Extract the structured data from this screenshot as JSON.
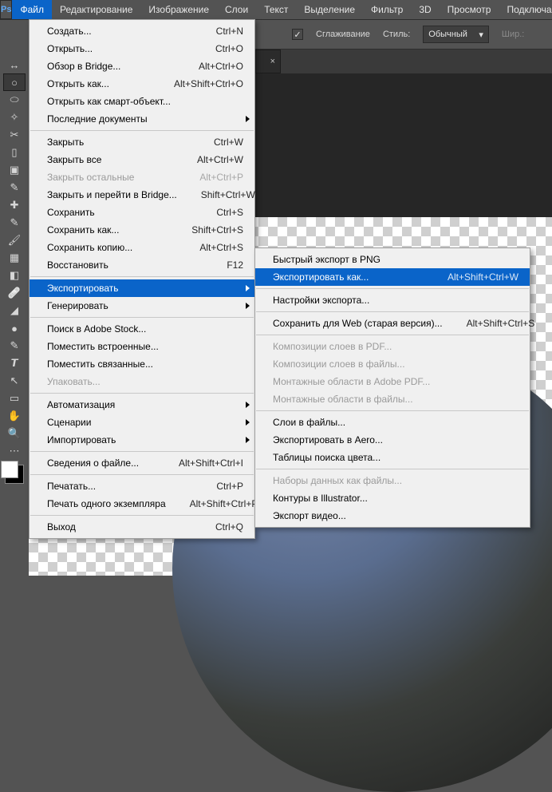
{
  "menubar": {
    "items": [
      "Файл",
      "Редактирование",
      "Изображение",
      "Слои",
      "Текст",
      "Выделение",
      "Фильтр",
      "3D",
      "Просмотр",
      "Подключаемые модул"
    ]
  },
  "options": {
    "smoothing_label": "Сглаживание",
    "style_label": "Стиль:",
    "style_value": "Обычный",
    "width_label": "Шир.:"
  },
  "tab": {
    "close_label": "×"
  },
  "file_menu": [
    {
      "type": "item",
      "label": "Создать...",
      "shortcut": "Ctrl+N"
    },
    {
      "type": "item",
      "label": "Открыть...",
      "shortcut": "Ctrl+O"
    },
    {
      "type": "item",
      "label": "Обзор в Bridge...",
      "shortcut": "Alt+Ctrl+O"
    },
    {
      "type": "item",
      "label": "Открыть как...",
      "shortcut": "Alt+Shift+Ctrl+O"
    },
    {
      "type": "item",
      "label": "Открыть как смарт-объект..."
    },
    {
      "type": "item",
      "label": "Последние документы",
      "submenu": true
    },
    {
      "type": "sep"
    },
    {
      "type": "item",
      "label": "Закрыть",
      "shortcut": "Ctrl+W"
    },
    {
      "type": "item",
      "label": "Закрыть все",
      "shortcut": "Alt+Ctrl+W"
    },
    {
      "type": "item",
      "label": "Закрыть остальные",
      "shortcut": "Alt+Ctrl+P",
      "disabled": true
    },
    {
      "type": "item",
      "label": "Закрыть и перейти в Bridge...",
      "shortcut": "Shift+Ctrl+W"
    },
    {
      "type": "item",
      "label": "Сохранить",
      "shortcut": "Ctrl+S"
    },
    {
      "type": "item",
      "label": "Сохранить как...",
      "shortcut": "Shift+Ctrl+S"
    },
    {
      "type": "item",
      "label": "Сохранить копию...",
      "shortcut": "Alt+Ctrl+S"
    },
    {
      "type": "item",
      "label": "Восстановить",
      "shortcut": "F12"
    },
    {
      "type": "sep"
    },
    {
      "type": "item",
      "label": "Экспортировать",
      "submenu": true,
      "highlight": true
    },
    {
      "type": "item",
      "label": "Генерировать",
      "submenu": true
    },
    {
      "type": "sep"
    },
    {
      "type": "item",
      "label": "Поиск в Adobe Stock..."
    },
    {
      "type": "item",
      "label": "Поместить встроенные..."
    },
    {
      "type": "item",
      "label": "Поместить связанные..."
    },
    {
      "type": "item",
      "label": "Упаковать...",
      "disabled": true
    },
    {
      "type": "sep"
    },
    {
      "type": "item",
      "label": "Автоматизация",
      "submenu": true
    },
    {
      "type": "item",
      "label": "Сценарии",
      "submenu": true
    },
    {
      "type": "item",
      "label": "Импортировать",
      "submenu": true
    },
    {
      "type": "sep"
    },
    {
      "type": "item",
      "label": "Сведения о файле...",
      "shortcut": "Alt+Shift+Ctrl+I"
    },
    {
      "type": "sep"
    },
    {
      "type": "item",
      "label": "Печатать...",
      "shortcut": "Ctrl+P"
    },
    {
      "type": "item",
      "label": "Печать одного экземпляра",
      "shortcut": "Alt+Shift+Ctrl+P"
    },
    {
      "type": "sep"
    },
    {
      "type": "item",
      "label": "Выход",
      "shortcut": "Ctrl+Q"
    }
  ],
  "export_submenu": [
    {
      "type": "item",
      "label": "Быстрый экспорт в PNG"
    },
    {
      "type": "item",
      "label": "Экспортировать как...",
      "shortcut": "Alt+Shift+Ctrl+W",
      "highlight": true
    },
    {
      "type": "sep"
    },
    {
      "type": "item",
      "label": "Настройки экспорта..."
    },
    {
      "type": "sep"
    },
    {
      "type": "item",
      "label": "Сохранить для Web (старая версия)...",
      "shortcut": "Alt+Shift+Ctrl+S"
    },
    {
      "type": "sep"
    },
    {
      "type": "item",
      "label": "Композиции слоев в PDF...",
      "disabled": true
    },
    {
      "type": "item",
      "label": "Композиции слоев в файлы...",
      "disabled": true
    },
    {
      "type": "item",
      "label": "Монтажные области в Adobe PDF...",
      "disabled": true
    },
    {
      "type": "item",
      "label": "Монтажные области в файлы...",
      "disabled": true
    },
    {
      "type": "sep"
    },
    {
      "type": "item",
      "label": "Слои в файлы..."
    },
    {
      "type": "item",
      "label": "Экспортировать в Aero..."
    },
    {
      "type": "item",
      "label": "Таблицы поиска цвета..."
    },
    {
      "type": "sep"
    },
    {
      "type": "item",
      "label": "Наборы данных как файлы...",
      "disabled": true
    },
    {
      "type": "item",
      "label": "Контуры в Illustrator..."
    },
    {
      "type": "item",
      "label": "Экспорт видео..."
    }
  ],
  "tools": [
    "↔",
    "○",
    "⬭",
    "✧",
    "✂",
    "▯",
    "▣",
    "✎",
    "✚",
    "✎",
    "🖌",
    "▦",
    "◧",
    "🩹",
    "◢",
    "●",
    "✎",
    "𝙏",
    "↖",
    "▭",
    "✋",
    "🔍",
    "⋯"
  ]
}
